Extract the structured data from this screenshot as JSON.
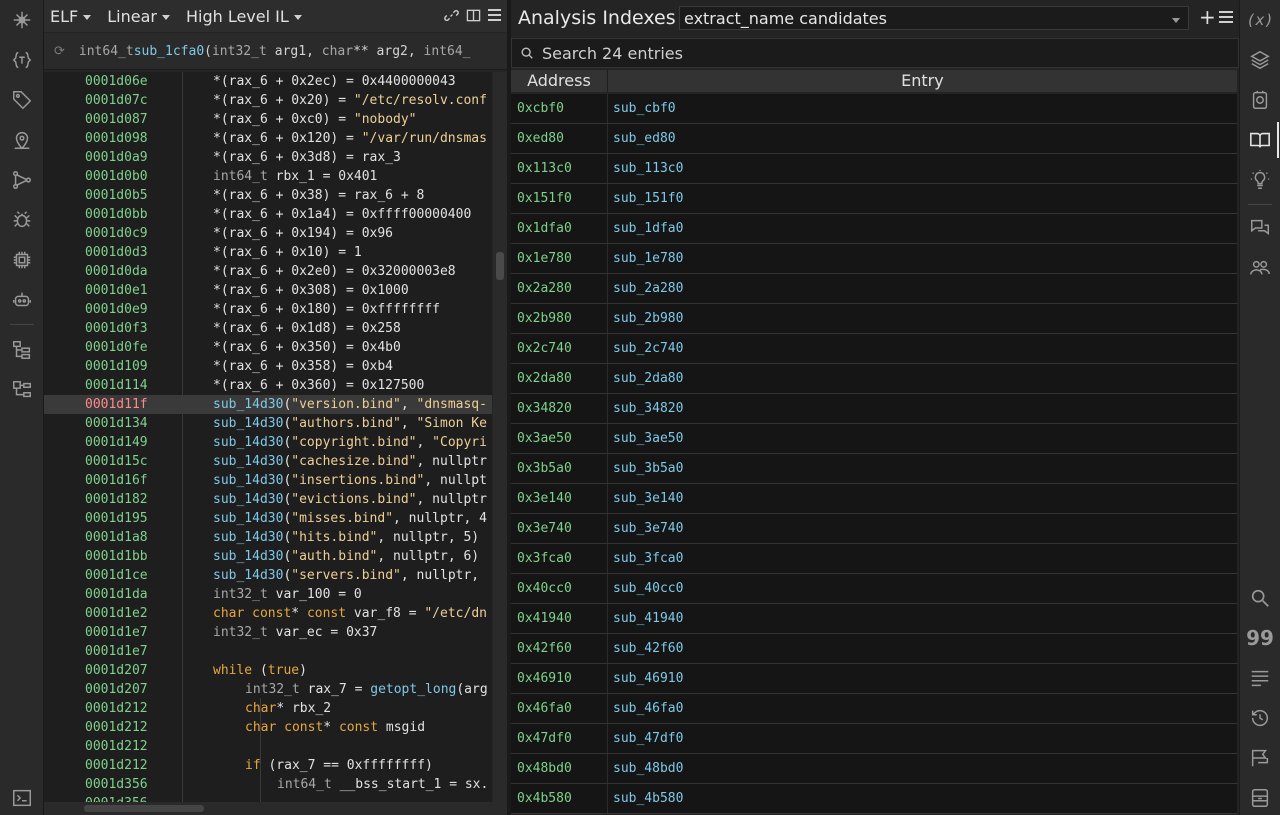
{
  "code_view": {
    "toolbar": {
      "file_type": "ELF",
      "view_mode": "Linear",
      "il_level": "High Level IL"
    },
    "signature": {
      "ret_type": "int64_t",
      "func_name": "sub_1cfa0",
      "params": [
        {
          "type": "int32_t",
          "name": "arg1",
          "sep": ", "
        },
        {
          "type": "char",
          "name": "** arg2",
          "sep": ", "
        },
        {
          "type": "int64_",
          "name": "",
          "sep": ""
        }
      ],
      "open_paren": "(",
      "space": " "
    },
    "lines": [
      {
        "addr": "0001d06e",
        "indent": 0,
        "parts": [
          [
            "p",
            "*(rax_6 + 0x2ec) = 0x4400000043"
          ]
        ]
      },
      {
        "addr": "0001d07c",
        "indent": 0,
        "parts": [
          [
            "p",
            "*(rax_6 + 0x20) = "
          ],
          [
            "s",
            "\"/etc/resolv.conf"
          ]
        ]
      },
      {
        "addr": "0001d087",
        "indent": 0,
        "parts": [
          [
            "p",
            "*(rax_6 + 0xc0) = "
          ],
          [
            "s",
            "\"nobody\""
          ]
        ]
      },
      {
        "addr": "0001d098",
        "indent": 0,
        "parts": [
          [
            "p",
            "*(rax_6 + 0x120) = "
          ],
          [
            "s",
            "\"/var/run/dnsmas"
          ]
        ]
      },
      {
        "addr": "0001d0a9",
        "indent": 0,
        "parts": [
          [
            "p",
            "*(rax_6 + 0x3d8) = rax_3"
          ]
        ]
      },
      {
        "addr": "0001d0b0",
        "indent": 0,
        "parts": [
          [
            "t",
            "int64_t "
          ],
          [
            "p",
            "rbx_1 = 0x401"
          ]
        ]
      },
      {
        "addr": "0001d0b5",
        "indent": 0,
        "parts": [
          [
            "p",
            "*(rax_6 + 0x38) = rax_6 + 8"
          ]
        ]
      },
      {
        "addr": "0001d0bb",
        "indent": 0,
        "parts": [
          [
            "p",
            "*(rax_6 + 0x1a4) = 0xffff00000400"
          ]
        ]
      },
      {
        "addr": "0001d0c9",
        "indent": 0,
        "parts": [
          [
            "p",
            "*(rax_6 + 0x194) = 0x96"
          ]
        ]
      },
      {
        "addr": "0001d0d3",
        "indent": 0,
        "parts": [
          [
            "p",
            "*(rax_6 + 0x10) = 1"
          ]
        ]
      },
      {
        "addr": "0001d0da",
        "indent": 0,
        "parts": [
          [
            "p",
            "*(rax_6 + 0x2e0) = 0x32000003e8"
          ]
        ]
      },
      {
        "addr": "0001d0e1",
        "indent": 0,
        "parts": [
          [
            "p",
            "*(rax_6 + 0x308) = 0x1000"
          ]
        ]
      },
      {
        "addr": "0001d0e9",
        "indent": 0,
        "parts": [
          [
            "p",
            "*(rax_6 + 0x180) = 0xffffffff"
          ]
        ]
      },
      {
        "addr": "0001d0f3",
        "indent": 0,
        "parts": [
          [
            "p",
            "*(rax_6 + 0x1d8) = 0x258"
          ]
        ]
      },
      {
        "addr": "0001d0fe",
        "indent": 0,
        "parts": [
          [
            "p",
            "*(rax_6 + 0x350) = 0x4b0"
          ]
        ]
      },
      {
        "addr": "0001d109",
        "indent": 0,
        "parts": [
          [
            "p",
            "*(rax_6 + 0x358) = 0xb4"
          ]
        ]
      },
      {
        "addr": "0001d114",
        "indent": 0,
        "parts": [
          [
            "p",
            "*(rax_6 + 0x360) = 0x127500"
          ]
        ]
      },
      {
        "addr": "0001d11f",
        "indent": 0,
        "hl": true,
        "parts": [
          [
            "f",
            "sub_14d30"
          ],
          [
            "p",
            "("
          ],
          [
            "s",
            "\"version.bind\""
          ],
          [
            "p",
            ", "
          ],
          [
            "s",
            "\"dnsmasq-"
          ]
        ]
      },
      {
        "addr": "0001d134",
        "indent": 0,
        "parts": [
          [
            "f",
            "sub_14d30"
          ],
          [
            "p",
            "("
          ],
          [
            "s",
            "\"authors.bind\""
          ],
          [
            "p",
            ", "
          ],
          [
            "s",
            "\"Simon Ke"
          ]
        ]
      },
      {
        "addr": "0001d149",
        "indent": 0,
        "parts": [
          [
            "f",
            "sub_14d30"
          ],
          [
            "p",
            "("
          ],
          [
            "s",
            "\"copyright.bind\""
          ],
          [
            "p",
            ", "
          ],
          [
            "s",
            "\"Copyri"
          ]
        ]
      },
      {
        "addr": "0001d15c",
        "indent": 0,
        "parts": [
          [
            "f",
            "sub_14d30"
          ],
          [
            "p",
            "("
          ],
          [
            "s",
            "\"cachesize.bind\""
          ],
          [
            "p",
            ", nullptr"
          ]
        ]
      },
      {
        "addr": "0001d16f",
        "indent": 0,
        "parts": [
          [
            "f",
            "sub_14d30"
          ],
          [
            "p",
            "("
          ],
          [
            "s",
            "\"insertions.bind\""
          ],
          [
            "p",
            ", nullpt"
          ]
        ]
      },
      {
        "addr": "0001d182",
        "indent": 0,
        "parts": [
          [
            "f",
            "sub_14d30"
          ],
          [
            "p",
            "("
          ],
          [
            "s",
            "\"evictions.bind\""
          ],
          [
            "p",
            ", nullptr"
          ]
        ]
      },
      {
        "addr": "0001d195",
        "indent": 0,
        "parts": [
          [
            "f",
            "sub_14d30"
          ],
          [
            "p",
            "("
          ],
          [
            "s",
            "\"misses.bind\""
          ],
          [
            "p",
            ", nullptr, 4"
          ]
        ]
      },
      {
        "addr": "0001d1a8",
        "indent": 0,
        "parts": [
          [
            "f",
            "sub_14d30"
          ],
          [
            "p",
            "("
          ],
          [
            "s",
            "\"hits.bind\""
          ],
          [
            "p",
            ", nullptr, 5)"
          ]
        ]
      },
      {
        "addr": "0001d1bb",
        "indent": 0,
        "parts": [
          [
            "f",
            "sub_14d30"
          ],
          [
            "p",
            "("
          ],
          [
            "s",
            "\"auth.bind\""
          ],
          [
            "p",
            ", nullptr, 6)"
          ]
        ]
      },
      {
        "addr": "0001d1ce",
        "indent": 0,
        "parts": [
          [
            "f",
            "sub_14d30"
          ],
          [
            "p",
            "("
          ],
          [
            "s",
            "\"servers.bind\""
          ],
          [
            "p",
            ", nullptr,"
          ]
        ]
      },
      {
        "addr": "0001d1da",
        "indent": 0,
        "parts": [
          [
            "t",
            "int32_t "
          ],
          [
            "p",
            "var_100 = 0"
          ]
        ]
      },
      {
        "addr": "0001d1e2",
        "indent": 0,
        "parts": [
          [
            "k",
            "char const"
          ],
          [
            "p",
            "* "
          ],
          [
            "k",
            "const"
          ],
          [
            "p",
            " var_f8 = "
          ],
          [
            "s",
            "\"/etc/dn"
          ]
        ]
      },
      {
        "addr": "0001d1e7",
        "indent": 0,
        "parts": [
          [
            "t",
            "int32_t "
          ],
          [
            "p",
            "var_ec = 0x37"
          ]
        ]
      },
      {
        "addr": "0001d1e7",
        "indent": 0,
        "parts": []
      },
      {
        "addr": "0001d207",
        "indent": 0,
        "parts": [
          [
            "k",
            "while"
          ],
          [
            "p",
            " ("
          ],
          [
            "k",
            "true"
          ],
          [
            "p",
            ")"
          ]
        ]
      },
      {
        "addr": "0001d207",
        "indent": 1,
        "parts": [
          [
            "t",
            "int32_t "
          ],
          [
            "p",
            "rax_7 = "
          ],
          [
            "f",
            "getopt_long"
          ],
          [
            "p",
            "(arg"
          ]
        ]
      },
      {
        "addr": "0001d212",
        "indent": 1,
        "parts": [
          [
            "k",
            "char"
          ],
          [
            "p",
            "* rbx_2"
          ]
        ]
      },
      {
        "addr": "0001d212",
        "indent": 1,
        "parts": [
          [
            "k",
            "char const"
          ],
          [
            "p",
            "* "
          ],
          [
            "k",
            "const"
          ],
          [
            "p",
            " msgid"
          ]
        ]
      },
      {
        "addr": "0001d212",
        "indent": 1,
        "parts": []
      },
      {
        "addr": "0001d212",
        "indent": 1,
        "parts": [
          [
            "k",
            "if"
          ],
          [
            "p",
            " (rax_7 == 0xffffffff)"
          ]
        ]
      },
      {
        "addr": "0001d356",
        "indent": 2,
        "parts": [
          [
            "t",
            "int64_t "
          ],
          [
            "p",
            "__bss_start_1 = sx."
          ]
        ]
      },
      {
        "addr": "0001d356",
        "indent": 2,
        "parts": []
      }
    ]
  },
  "analysis": {
    "title": "Analysis Indexes",
    "selected_index": "extract_name candidates",
    "search_placeholder": "Search 24 entries",
    "columns": [
      "Address",
      "Entry"
    ],
    "rows": [
      [
        "0xcbf0",
        "sub_cbf0"
      ],
      [
        "0xed80",
        "sub_ed80"
      ],
      [
        "0x113c0",
        "sub_113c0"
      ],
      [
        "0x151f0",
        "sub_151f0"
      ],
      [
        "0x1dfa0",
        "sub_1dfa0"
      ],
      [
        "0x1e780",
        "sub_1e780"
      ],
      [
        "0x2a280",
        "sub_2a280"
      ],
      [
        "0x2b980",
        "sub_2b980"
      ],
      [
        "0x2c740",
        "sub_2c740"
      ],
      [
        "0x2da80",
        "sub_2da80"
      ],
      [
        "0x34820",
        "sub_34820"
      ],
      [
        "0x3ae50",
        "sub_3ae50"
      ],
      [
        "0x3b5a0",
        "sub_3b5a0"
      ],
      [
        "0x3e140",
        "sub_3e140"
      ],
      [
        "0x3e740",
        "sub_3e740"
      ],
      [
        "0x3fca0",
        "sub_3fca0"
      ],
      [
        "0x40cc0",
        "sub_40cc0"
      ],
      [
        "0x41940",
        "sub_41940"
      ],
      [
        "0x42f60",
        "sub_42f60"
      ],
      [
        "0x46910",
        "sub_46910"
      ],
      [
        "0x46fa0",
        "sub_46fa0"
      ],
      [
        "0x47df0",
        "sub_47df0"
      ],
      [
        "0x48bd0",
        "sub_48bd0"
      ],
      [
        "0x4b580",
        "sub_4b580"
      ]
    ]
  },
  "colors": {
    "address": "#7fd18b",
    "string": "#eecf96",
    "function": "#7fc8e8",
    "keyword": "#e6a640"
  },
  "right_bar": {
    "variables_label": "(x)",
    "quotes_label": "99"
  }
}
